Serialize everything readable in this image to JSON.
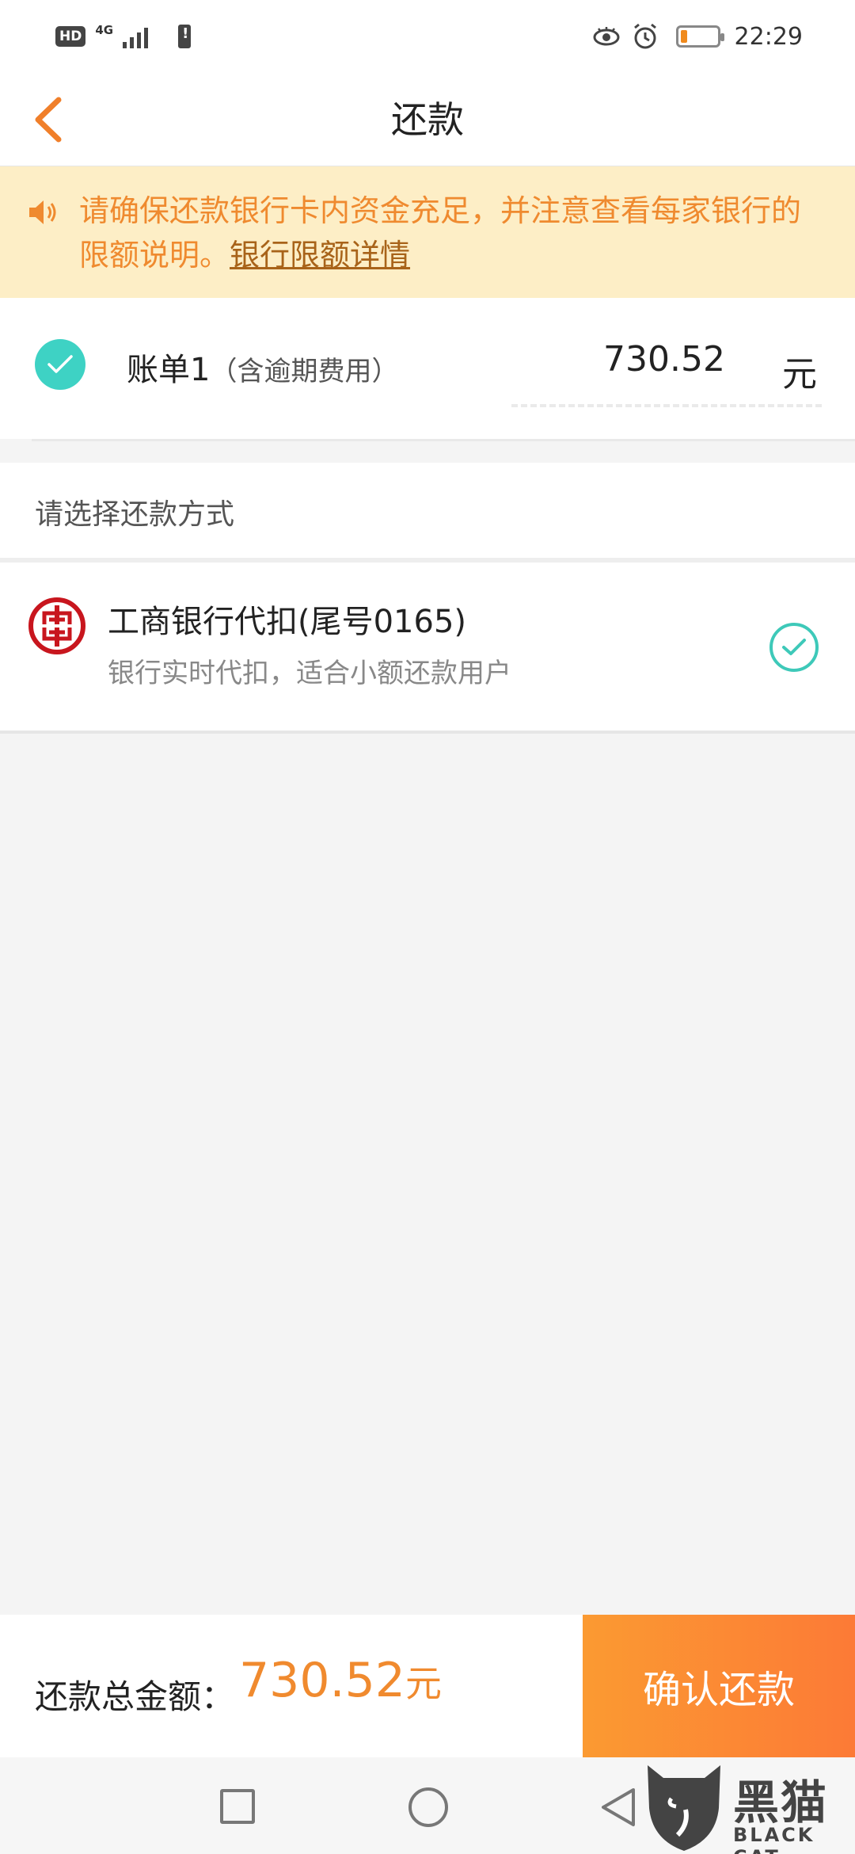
{
  "status_bar": {
    "hd": "HD",
    "network": "4G",
    "time": "22:29",
    "battery_level": 0.18,
    "icons": [
      "signal-icon",
      "battery-warning-icon",
      "eye-icon",
      "alarm-icon",
      "battery-icon"
    ]
  },
  "nav": {
    "title": "还款",
    "back_icon": "chevron-left-icon"
  },
  "notice": {
    "icon": "speaker-icon",
    "text": "请确保还款银行卡内资金充足，并注意查看每家银行的限额说明。",
    "link": "银行限额详情"
  },
  "bill": {
    "title": "账单1",
    "subtitle": "（含逾期费用）",
    "amount": "730.52",
    "unit": "元",
    "checked": true
  },
  "payment": {
    "header": "请选择还款方式",
    "method_title": "工商银行代扣(尾号0165)",
    "method_desc": "银行实时代扣，适合小额还款用户",
    "selected": true
  },
  "footer": {
    "total_label": "还款总金额：",
    "total_amount": "730.52",
    "total_unit": "元",
    "confirm_label": "确认还款"
  },
  "watermark": {
    "title": "黑猫",
    "subtitle": "BLACK CAT"
  },
  "colors": {
    "accent_orange": "#f08a2e",
    "teal": "#3ed2c4",
    "notice_bg": "#fdeec6"
  }
}
